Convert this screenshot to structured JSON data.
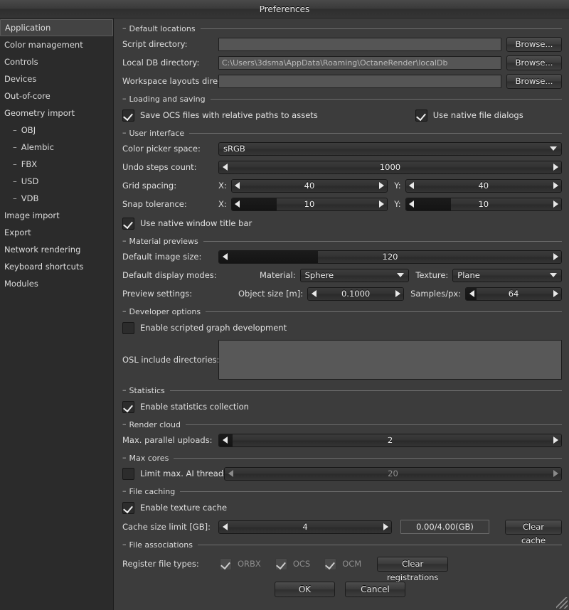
{
  "window": {
    "title": "Preferences"
  },
  "sidebar": {
    "items": [
      {
        "label": "Application",
        "selected": true,
        "sub": false
      },
      {
        "label": "Color management",
        "selected": false,
        "sub": false
      },
      {
        "label": "Controls",
        "selected": false,
        "sub": false
      },
      {
        "label": "Devices",
        "selected": false,
        "sub": false
      },
      {
        "label": "Out-of-core",
        "selected": false,
        "sub": false
      },
      {
        "label": "Geometry import",
        "selected": false,
        "sub": false
      },
      {
        "label": "OBJ",
        "selected": false,
        "sub": true
      },
      {
        "label": "Alembic",
        "selected": false,
        "sub": true
      },
      {
        "label": "FBX",
        "selected": false,
        "sub": true
      },
      {
        "label": "USD",
        "selected": false,
        "sub": true
      },
      {
        "label": "VDB",
        "selected": false,
        "sub": true
      },
      {
        "label": "Image import",
        "selected": false,
        "sub": false
      },
      {
        "label": "Export",
        "selected": false,
        "sub": false
      },
      {
        "label": "Network rendering",
        "selected": false,
        "sub": false
      },
      {
        "label": "Keyboard shortcuts",
        "selected": false,
        "sub": false
      },
      {
        "label": "Modules",
        "selected": false,
        "sub": false
      }
    ]
  },
  "groups": {
    "default_locations": "Default locations",
    "loading_and_saving": "Loading and saving",
    "user_interface": "User interface",
    "material_previews": "Material previews",
    "developer_options": "Developer options",
    "statistics": "Statistics",
    "render_cloud": "Render cloud",
    "max_cores": "Max cores",
    "file_caching": "File caching",
    "file_associations": "File associations",
    "marker": "–"
  },
  "default_locations": {
    "script_directory": {
      "label": "Script directory:",
      "value": "",
      "browse": "Browse..."
    },
    "local_db_directory": {
      "label": "Local DB directory:",
      "value": "C:\\Users\\3dsma\\AppData\\Roaming\\OctaneRender\\localDb",
      "browse": "Browse..."
    },
    "workspace_layouts_directory": {
      "label": "Workspace layouts directory:",
      "value": "",
      "browse": "Browse..."
    }
  },
  "loading_and_saving": {
    "save_ocs_relative": {
      "label": "Save OCS files with relative paths to assets",
      "checked": true
    },
    "use_native_file_dialogs": {
      "label": "Use native file dialogs",
      "checked": true
    }
  },
  "user_interface": {
    "color_picker_space": {
      "label": "Color picker space:",
      "value": "sRGB"
    },
    "undo_steps_count": {
      "label": "Undo steps count:",
      "value": "1000",
      "fill_pct": 0
    },
    "grid_spacing": {
      "label": "Grid spacing:",
      "x_label": "X:",
      "x_value": "40",
      "x_fill_pct": 0,
      "y_label": "Y:",
      "y_value": "40",
      "y_fill_pct": 0
    },
    "snap_tolerance": {
      "label": "Snap tolerance:",
      "x_label": "X:",
      "x_value": "10",
      "x_fill_pct": 29,
      "y_label": "Y:",
      "y_value": "10",
      "y_fill_pct": 29
    },
    "use_native_title_bar": {
      "label": "Use native window title bar",
      "checked": true
    }
  },
  "material_previews": {
    "default_image_size": {
      "label": "Default image size:",
      "value": "120",
      "fill_pct": 29
    },
    "default_display_modes": {
      "label": "Default display modes:",
      "material_label": "Material:",
      "material_value": "Sphere",
      "texture_label": "Texture:",
      "texture_value": "Plane"
    },
    "preview_settings": {
      "label": "Preview settings:",
      "object_size_label": "Object size [m]:",
      "object_size_value": "0.1000",
      "object_size_fill_pct": 0,
      "samples_label": "Samples/px:",
      "samples_value": "64",
      "samples_fill_pct": 11
    }
  },
  "developer_options": {
    "enable_scripted_graph": {
      "label": "Enable scripted graph development",
      "checked": false
    },
    "osl_include_directories": {
      "label": "OSL include directories:",
      "value": ""
    }
  },
  "statistics": {
    "enable_statistics_collection": {
      "label": "Enable statistics collection",
      "checked": true
    }
  },
  "render_cloud": {
    "max_parallel_uploads": {
      "label": "Max. parallel uploads:",
      "value": "2",
      "fill_pct": 4
    }
  },
  "max_cores": {
    "limit_ai_threads": {
      "label": "Limit max. AI threads:",
      "checked": false,
      "value": "20",
      "fill_pct": 0,
      "disabled": true
    }
  },
  "file_caching": {
    "enable_texture_cache": {
      "label": "Enable texture cache",
      "checked": true
    },
    "cache_size_limit": {
      "label": "Cache size limit [GB]:",
      "value": "4",
      "fill_pct": 0
    },
    "cache_usage": "0.00/4.00(GB)",
    "clear_cache": "Clear cache"
  },
  "file_associations": {
    "register_file_types": "Register file types:",
    "types": [
      {
        "label": "ORBX",
        "checked": true,
        "disabled": true
      },
      {
        "label": "OCS",
        "checked": true,
        "disabled": true
      },
      {
        "label": "OCM",
        "checked": true,
        "disabled": true
      }
    ],
    "clear_registrations": "Clear registrations"
  },
  "footer": {
    "ok": "OK",
    "cancel": "Cancel"
  },
  "colors": {
    "window_bg": "#3c3c3c",
    "sidebar_bg": "#2b2b2b",
    "text": "#dedede",
    "input_bg": "#555555",
    "group_line": "#6e6e6e"
  }
}
